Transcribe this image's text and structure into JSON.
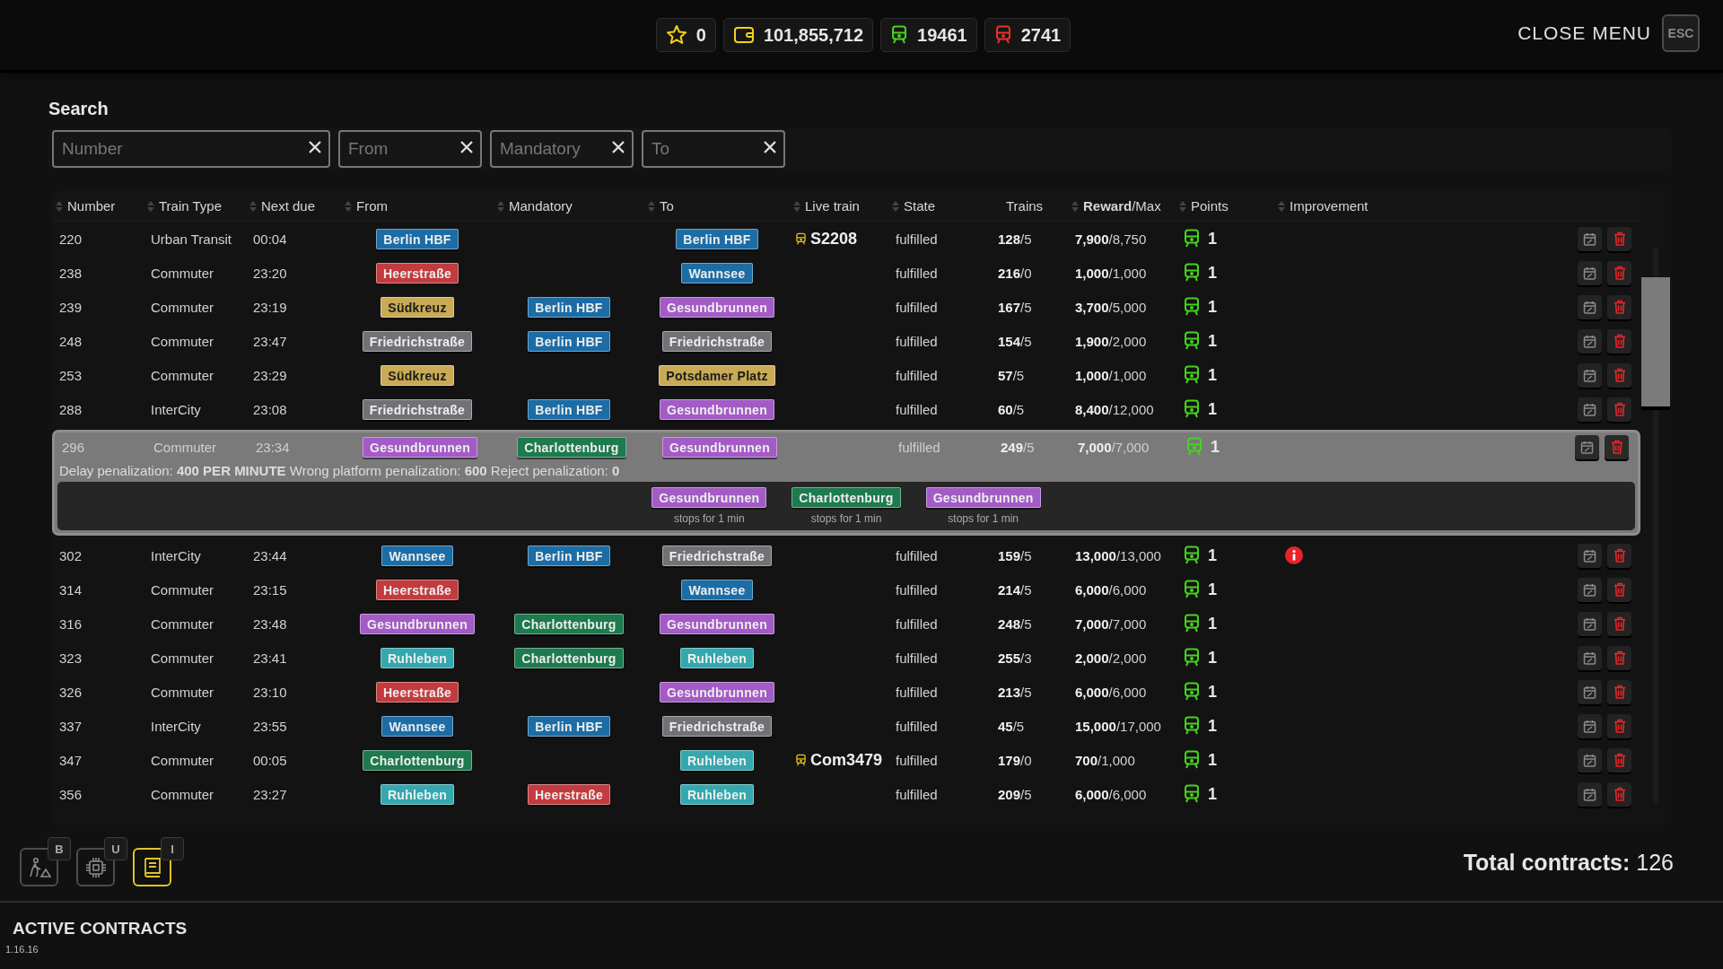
{
  "top_bar": {
    "stats": [
      {
        "kind": "star",
        "color": "#f2d21b",
        "value": "0"
      },
      {
        "kind": "wallet",
        "color": "#f2d21b",
        "value": "101,855,712"
      },
      {
        "kind": "train",
        "color": "#45d31f",
        "value": "19461"
      },
      {
        "kind": "train",
        "color": "#e8302c",
        "value": "2741"
      }
    ],
    "close_label": "CLOSE MENU",
    "close_key": "ESC"
  },
  "search": {
    "title": "Search",
    "fields": [
      {
        "placeholder": "Number"
      },
      {
        "placeholder": "From"
      },
      {
        "placeholder": "Mandatory"
      },
      {
        "placeholder": "To"
      }
    ]
  },
  "table": {
    "columns": [
      {
        "label": "Number",
        "sortable": true
      },
      {
        "label": "Train Type",
        "sortable": true
      },
      {
        "label": "Next due",
        "sortable": true
      },
      {
        "label": "From",
        "sortable": true
      },
      {
        "label": "Mandatory",
        "sortable": true
      },
      {
        "label": "To",
        "sortable": true
      },
      {
        "label": "Live train",
        "sortable": true
      },
      {
        "label": "State",
        "sortable": true
      },
      {
        "label": "Trains",
        "sortable": false
      },
      {
        "label": "**Reward**/Max",
        "sortable": true
      },
      {
        "label": "Points",
        "sortable": true
      },
      {
        "label": "Improvement",
        "sortable": true
      }
    ],
    "rows": [
      {
        "number": "220",
        "train_type": "Urban Transit",
        "next_due": "00:04",
        "from": {
          "name": "Berlin HBF",
          "color": "#1c6ca5"
        },
        "to": {
          "name": "Berlin HBF",
          "color": "#1c6ca5"
        },
        "live_train": "S2208",
        "state": "fulfilled",
        "trains": "**128**/5",
        "reward": "**7,900**/8,750",
        "points": "1",
        "alert": false,
        "expanded": false
      },
      {
        "number": "238",
        "train_type": "Commuter",
        "next_due": "23:20",
        "from": {
          "name": "Heerstraße",
          "color": "#c23b3e"
        },
        "to": {
          "name": "Wannsee",
          "color": "#1c6ca5"
        },
        "state": "fulfilled",
        "trains": "**216**/0",
        "reward": "**1,000**/1,000",
        "points": "1",
        "alert": false,
        "expanded": false
      },
      {
        "number": "239",
        "train_type": "Commuter",
        "next_due": "23:19",
        "from": {
          "name": "Südkreuz",
          "color": "#c9aa55"
        },
        "mandatory": {
          "name": "Berlin HBF",
          "color": "#1c6ca5"
        },
        "to": {
          "name": "Gesundbrunnen",
          "color": "#a35bc6"
        },
        "state": "fulfilled",
        "trains": "**167**/5",
        "reward": "**3,700**/5,000",
        "points": "1",
        "alert": false,
        "expanded": false
      },
      {
        "number": "248",
        "train_type": "Commuter",
        "next_due": "23:47",
        "from": {
          "name": "Friedrichstraße",
          "color": "#717176"
        },
        "mandatory": {
          "name": "Berlin HBF",
          "color": "#1c6ca5"
        },
        "to": {
          "name": "Friedrichstraße",
          "color": "#717176"
        },
        "state": "fulfilled",
        "trains": "**154**/5",
        "reward": "**1,900**/2,000",
        "points": "1",
        "alert": false,
        "expanded": false
      },
      {
        "number": "253",
        "train_type": "Commuter",
        "next_due": "23:29",
        "from": {
          "name": "Südkreuz",
          "color": "#c9aa55"
        },
        "to": {
          "name": "Potsdamer Platz",
          "color": "#c9aa55"
        },
        "state": "fulfilled",
        "trains": "**57**/5",
        "reward": "**1,000**/1,000",
        "points": "1",
        "alert": false,
        "expanded": false
      },
      {
        "number": "288",
        "train_type": "InterCity",
        "next_due": "23:08",
        "from": {
          "name": "Friedrichstraße",
          "color": "#717176"
        },
        "mandatory": {
          "name": "Berlin HBF",
          "color": "#1c6ca5"
        },
        "to": {
          "name": "Gesundbrunnen",
          "color": "#a35bc6"
        },
        "state": "fulfilled",
        "trains": "**60**/5",
        "reward": "**8,400**/12,000",
        "points": "1",
        "alert": false,
        "expanded": false
      },
      {
        "number": "296",
        "train_type": "Commuter",
        "next_due": "23:34",
        "from": {
          "name": "Gesundbrunnen",
          "color": "#a35bc6"
        },
        "mandatory": {
          "name": "Charlottenburg",
          "color": "#1e7a4f"
        },
        "to": {
          "name": "Gesundbrunnen",
          "color": "#a35bc6"
        },
        "state": "fulfilled",
        "trains": "**249**/5",
        "reward": "**7,000**/7,000",
        "points": "1",
        "alert": false,
        "expanded": true,
        "details": {
          "penalties": "Delay penalization: **400 PER MINUTE** Wrong platform penalization: **600** Reject penalization: **0**",
          "stops": [
            {
              "name": "Gesundbrunnen",
              "color": "#a35bc6",
              "note": "stops for 1 min"
            },
            {
              "name": "Charlottenburg",
              "color": "#1e7a4f",
              "note": "stops for 1 min"
            },
            {
              "name": "Gesundbrunnen",
              "color": "#a35bc6",
              "note": "stops for 1 min"
            }
          ]
        }
      },
      {
        "number": "302",
        "train_type": "InterCity",
        "next_due": "23:44",
        "from": {
          "name": "Wannsee",
          "color": "#1c6ca5"
        },
        "mandatory": {
          "name": "Berlin HBF",
          "color": "#1c6ca5"
        },
        "to": {
          "name": "Friedrichstraße",
          "color": "#717176"
        },
        "state": "fulfilled",
        "trains": "**159**/5",
        "reward": "**13,000**/13,000",
        "points": "1",
        "alert": true,
        "expanded": false
      },
      {
        "number": "314",
        "train_type": "Commuter",
        "next_due": "23:15",
        "from": {
          "name": "Heerstraße",
          "color": "#c23b3e"
        },
        "to": {
          "name": "Wannsee",
          "color": "#1c6ca5"
        },
        "state": "fulfilled",
        "trains": "**214**/5",
        "reward": "**6,000**/6,000",
        "points": "1",
        "alert": false,
        "expanded": false
      },
      {
        "number": "316",
        "train_type": "Commuter",
        "next_due": "23:48",
        "from": {
          "name": "Gesundbrunnen",
          "color": "#a35bc6"
        },
        "mandatory": {
          "name": "Charlottenburg",
          "color": "#1e7a4f"
        },
        "to": {
          "name": "Gesundbrunnen",
          "color": "#a35bc6"
        },
        "state": "fulfilled",
        "trains": "**248**/5",
        "reward": "**7,000**/7,000",
        "points": "1",
        "alert": false,
        "expanded": false
      },
      {
        "number": "323",
        "train_type": "Commuter",
        "next_due": "23:41",
        "from": {
          "name": "Ruhleben",
          "color": "#34a8ae"
        },
        "mandatory": {
          "name": "Charlottenburg",
          "color": "#1e7a4f"
        },
        "to": {
          "name": "Ruhleben",
          "color": "#34a8ae"
        },
        "state": "fulfilled",
        "trains": "**255**/3",
        "reward": "**2,000**/2,000",
        "points": "1",
        "alert": false,
        "expanded": false
      },
      {
        "number": "326",
        "train_type": "Commuter",
        "next_due": "23:10",
        "from": {
          "name": "Heerstraße",
          "color": "#c23b3e"
        },
        "to": {
          "name": "Gesundbrunnen",
          "color": "#a35bc6"
        },
        "state": "fulfilled",
        "trains": "**213**/5",
        "reward": "**6,000**/6,000",
        "points": "1",
        "alert": false,
        "expanded": false
      },
      {
        "number": "337",
        "train_type": "InterCity",
        "next_due": "23:55",
        "from": {
          "name": "Wannsee",
          "color": "#1c6ca5"
        },
        "mandatory": {
          "name": "Berlin HBF",
          "color": "#1c6ca5"
        },
        "to": {
          "name": "Friedrichstraße",
          "color": "#717176"
        },
        "state": "fulfilled",
        "trains": "**45**/5",
        "reward": "**15,000**/17,000",
        "points": "1",
        "alert": false,
        "expanded": false
      },
      {
        "number": "347",
        "train_type": "Commuter",
        "next_due": "00:05",
        "from": {
          "name": "Charlottenburg",
          "color": "#1e7a4f"
        },
        "to": {
          "name": "Ruhleben",
          "color": "#34a8ae"
        },
        "live_train": "Com3479",
        "state": "fulfilled",
        "trains": "**179**/0",
        "reward": "**700**/1,000",
        "points": "1",
        "alert": false,
        "expanded": false
      },
      {
        "number": "356",
        "train_type": "Commuter",
        "next_due": "23:27",
        "from": {
          "name": "Ruhleben",
          "color": "#34a8ae"
        },
        "mandatory": {
          "name": "Heerstraße",
          "color": "#c23b3e"
        },
        "to": {
          "name": "Ruhleben",
          "color": "#34a8ae"
        },
        "state": "fulfilled",
        "trains": "**209**/5",
        "reward": "**6,000**/6,000",
        "points": "1",
        "alert": false,
        "expanded": false
      }
    ]
  },
  "toolbar": {
    "tools": [
      {
        "kind": "construction",
        "key": "B",
        "selected": false
      },
      {
        "kind": "chip",
        "key": "U",
        "selected": false
      },
      {
        "kind": "book",
        "key": "I",
        "selected": true
      }
    ]
  },
  "footer": {
    "total": "**Total contracts:** 126",
    "section_title": "ACTIVE CONTRACTS",
    "version": "1.16.16"
  }
}
